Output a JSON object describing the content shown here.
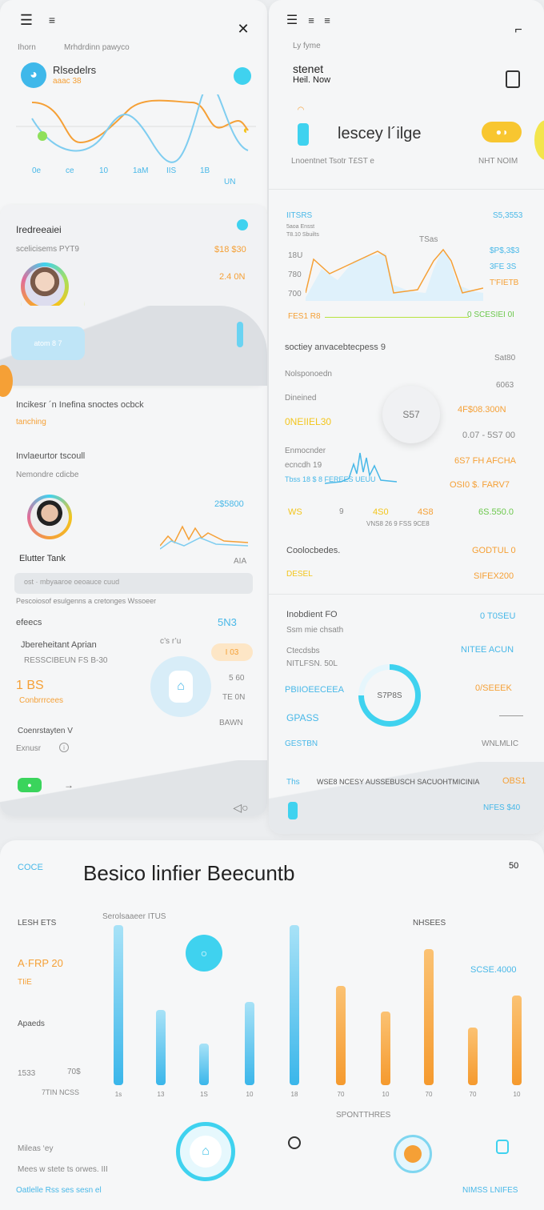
{
  "left": {
    "nav_label": "Ihorn",
    "subtitle": "Mrhdrdinn pawyco",
    "card1_title": "Rlsedelrs",
    "card1_sub": "aaac 38",
    "xticks": [
      "0e",
      "ce",
      "10",
      "1aM",
      "IIS",
      "1B"
    ],
    "xextra": "UN",
    "c2_title": "Iredreeaiei",
    "c2_sub": "scelicisems PYT9",
    "c2_val1": "$18 $30",
    "c2_val2": "2.4 0N",
    "c2_pill": "atom 8 7",
    "sec3_title": "Incikesr ´n Inefina snoctes ocbck",
    "sec3_sub": "tanching",
    "sec4_title": "Invlaeurtor tscoull",
    "sec4_sub": "Nemondre cdicbe",
    "s4_val": "2$5800",
    "s4_wave_lbl": "AIA",
    "person_name": "Elutter Tank",
    "input_text": "ost · mbyaaroe  oeoauce  cuud",
    "s4_caption": "Pescoiosof esulgenns a cretonges Wssoeer",
    "sec5_title": "efeecs",
    "sec5_val": "5N3",
    "s5_icons": "c’s  r’u",
    "s5_l1": "Jbereheitant Aprian",
    "s5_l2": "RESSCIBEUN FS B-30",
    "s5_badge": "I 03",
    "big_val": "1 BS",
    "big_sub": "Conbrrrcees",
    "s5_r1": "5 60",
    "s5_r2": "TE 0N",
    "s5_r3": "BAWN",
    "s5_l3": "Coenrstayten V",
    "s5_l4": "Exnusr"
  },
  "right": {
    "label": "Ly fyme",
    "title_l1": "stenet",
    "title_l2": "Heil. Now",
    "big_title": "lescey l´ilge",
    "sub": "Lnoentnet Tsotr T£ST e",
    "sub_right": "NHT NOIM",
    "chart_l": "IITSRS",
    "chart_r": "S5,3553",
    "chart_lbl1": "5aoa Ensst",
    "chart_lbl2": "T8.10 Sbuilts",
    "chart_peak": "TSas",
    "y_ticks": [
      "18U",
      "780",
      "700"
    ],
    "r_vals": [
      "$P$,3$3",
      "3FE 3S",
      "T'FIETB"
    ],
    "x_left": "FES1 R8",
    "x_right": "0 SCESIEI 0I",
    "s2_title": "soctiey anvacebtecpess 9",
    "s2_right": "Sat80",
    "s2_row1": "Nolsponoedn",
    "s2_row1v": "6063",
    "s2_row2": "Dineined",
    "s2_row2v1": "0NEIIEL30",
    "ring_val": "S57",
    "s2_row2v2": "4F$08.300N",
    "s2_row2v3": "0.07 - 5S7 00",
    "s2_row3a": "Enmocnder",
    "s2_row3b": "ecncdh 19",
    "s2_row3c": "Tbss 18 $ 8 FEREES UEUU",
    "s2_r3v1": "6S7 FH AFCHA",
    "s2_r3v2": "OSI0 $. FARV7",
    "s2_row4": [
      "WS",
      "9",
      "4S0",
      "4S8"
    ],
    "s2_r4v": "6S.550.0",
    "s2_r4c": "VNS8 26 9 FSS 9CE8",
    "s3_title": "Coolocbedes.",
    "s3_r": "GODTUL 0",
    "s3_a": "DESEL",
    "s3_b": "SIFEX200",
    "s4_title": "Inobdient FO",
    "s4_v": "0 T0SEU",
    "s4_sub": "Ssm mie chsath",
    "s4_r1": "Ctecdsbs",
    "s4_r1b": "NITLFSN. 50L",
    "s4_r1v": "NITEE ACUN",
    "s4_r2": "PBIIOEECEEA",
    "ring2": "S7P8S",
    "s4_r2v": "0/SEEEK",
    "s4_r3": "GPASS",
    "s4_r4": "GESTBN",
    "s4_r4v": "WNLMLIC",
    "foot1": "WSE8 NCESY AUSSEBUSCH SACUOHTMICINIA",
    "foot1v": "OBS1",
    "foot_icon": "Ths",
    "foot2v": "NFES $40"
  },
  "bottom": {
    "tag": "COCE",
    "title": "Besico linfier Beecuntb",
    "corner": "50",
    "center_label": "Serolsaaeer ITUS",
    "right_label": "NHSEES",
    "y1": "LESH ETS",
    "y2": "A·FRP 20",
    "y3": "TIiE",
    "y4": "Apaeds",
    "y5": "1533",
    "y6": "70$",
    "y7": "7TIN NCSS",
    "r1": "SCSE.4000",
    "xticks_l": [
      "1s",
      "13",
      "1S",
      "10",
      "18"
    ],
    "xticks_r": [
      "70",
      "10",
      "70",
      "70",
      "10"
    ],
    "label_mid": "SPONTTHRES",
    "f1": "Mileas ‘ey",
    "f2": "Mees w stete ts orwes. III",
    "f3": "Oatlelle Rss ses sesn el",
    "f4": "NIMSS LNIFES"
  },
  "chart_data": [
    {
      "type": "bar",
      "title": "",
      "series": [
        {
          "name": "",
          "values": [
            100,
            47,
            26,
            52,
            100
          ]
        }
      ]
    },
    {
      "type": "bar",
      "title": "",
      "series": [
        {
          "name": "",
          "values": [
            62,
            46,
            85,
            36,
            56
          ]
        }
      ]
    }
  ],
  "colors": {
    "orange": "#f5a036",
    "blue": "#48b8e8",
    "yellow": "#f3c51c",
    "green": "#6cc84c",
    "cyan": "#3fd2ef"
  }
}
